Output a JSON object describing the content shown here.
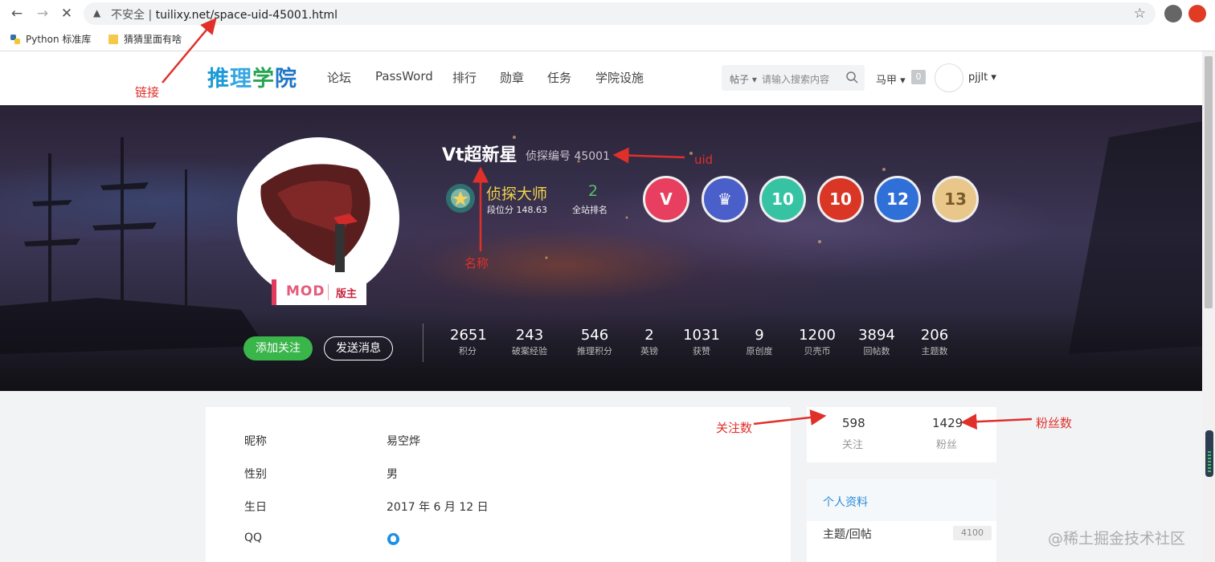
{
  "browser": {
    "security_label": "不安全",
    "url": "tuilixy.net/space-uid-45001.html",
    "bookmarks": [
      "Python 标准库",
      "猜猜里面有啥"
    ]
  },
  "site": {
    "logo_text": [
      "推",
      "理",
      "学",
      "院"
    ],
    "menu": [
      "论坛",
      "PassWord",
      "排行",
      "勋章",
      "任务",
      "学院设施"
    ],
    "search_select": "帖子",
    "search_placeholder": "请输入搜索内容",
    "header_dropdown": "马甲",
    "header_badge": "0",
    "username": "pjjlt"
  },
  "profile": {
    "name": "Vt超新星",
    "uid_text": "侦探编号 45001",
    "mod_label": "MOD",
    "mod_role": "版主",
    "rank_title": "侦探大师",
    "rank_score": "段位分 148.63",
    "site_rank": "2",
    "site_rank_label": "全站排名",
    "medals": [
      {
        "text": "V",
        "color": "#e83e5f"
      },
      {
        "text": "♛",
        "color": "#4a5fc9"
      },
      {
        "text": "10",
        "color": "#35c3a4"
      },
      {
        "text": "10",
        "color": "#d93626"
      },
      {
        "text": "12",
        "color": "#2f6fd8"
      },
      {
        "text": "13",
        "color": "#e9c78a"
      }
    ],
    "follow_button": "添加关注",
    "message_button": "发送消息",
    "stats": [
      {
        "value": "2651",
        "label": "积分"
      },
      {
        "value": "243",
        "label": "破案经验"
      },
      {
        "value": "546",
        "label": "推理积分"
      },
      {
        "value": "2",
        "label": "英镑"
      },
      {
        "value": "1031",
        "label": "获赞"
      },
      {
        "value": "9",
        "label": "原创度"
      },
      {
        "value": "1200",
        "label": "贝壳币"
      },
      {
        "value": "3894",
        "label": "回帖数"
      },
      {
        "value": "206",
        "label": "主题数"
      }
    ]
  },
  "info": [
    {
      "label": "昵称",
      "value": "易空烨"
    },
    {
      "label": "性别",
      "value": "男"
    },
    {
      "label": "生日",
      "value": "2017 年 6 月 12 日"
    },
    {
      "label": "QQ",
      "value": ""
    }
  ],
  "follow": {
    "following_count": "598",
    "following_label": "关注",
    "fans_count": "1429",
    "fans_label": "粉丝"
  },
  "side_profile": {
    "title": "个人资料",
    "rows": [
      {
        "label": "主题/回帖",
        "count": "4100"
      }
    ]
  },
  "annotations": {
    "link": "链接",
    "uid": "uid",
    "name": "名称",
    "following": "关注数",
    "fans": "粉丝数"
  },
  "watermark": "@稀土掘金技术社区"
}
